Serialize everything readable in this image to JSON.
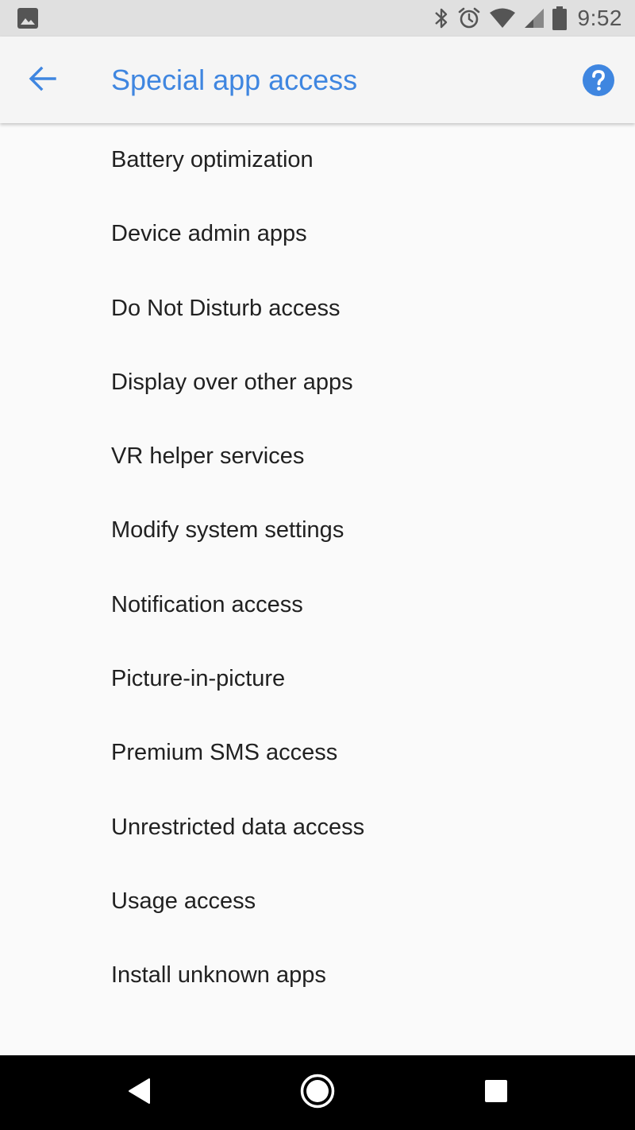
{
  "status_bar": {
    "time": "9:52",
    "icons": [
      "image-notification-icon",
      "bluetooth-icon",
      "alarm-icon",
      "wifi-icon",
      "cell-signal-icon",
      "battery-icon"
    ]
  },
  "app_bar": {
    "title": "Special app access",
    "back_icon": "arrow-back-icon",
    "help_icon": "help-icon"
  },
  "list": {
    "items": [
      {
        "label": "Battery optimization"
      },
      {
        "label": "Device admin apps"
      },
      {
        "label": "Do Not Disturb access"
      },
      {
        "label": "Display over other apps"
      },
      {
        "label": "VR helper services"
      },
      {
        "label": "Modify system settings"
      },
      {
        "label": "Notification access"
      },
      {
        "label": "Picture-in-picture"
      },
      {
        "label": "Premium SMS access"
      },
      {
        "label": "Unrestricted data access"
      },
      {
        "label": "Usage access"
      },
      {
        "label": "Install unknown apps"
      }
    ]
  },
  "nav_bar": {
    "icons": [
      "back-triangle-icon",
      "home-circle-icon",
      "recents-square-icon"
    ]
  },
  "colors": {
    "accent": "#3f86e0",
    "background": "#fafafa",
    "app_bar": "#f5f5f5",
    "status_bar": "#e0e0e0",
    "text": "#212121",
    "nav_bar": "#000000"
  }
}
